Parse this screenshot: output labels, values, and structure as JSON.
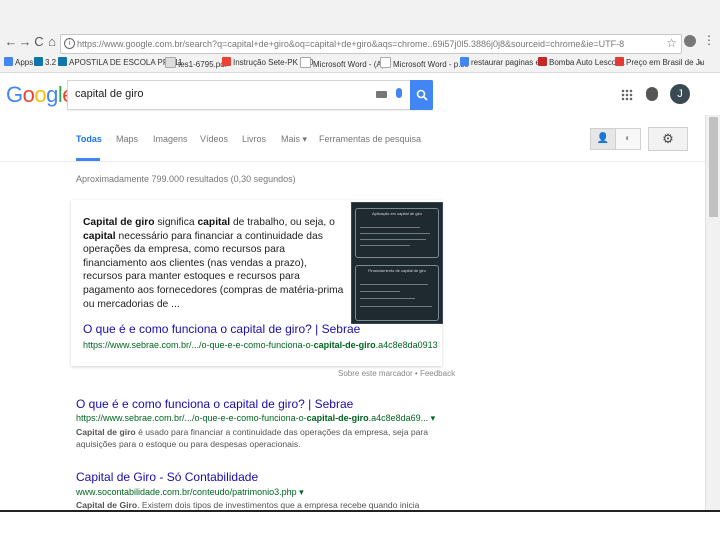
{
  "browser": {
    "url": "https://www.google.com.br/search?q=capital+de+giro&oq=capital+de+giro&aqs=chrome..69i57j0l5.3886j0j8&sourceid=chrome&ie=UTF-8",
    "nav_icons": {
      "back": "←",
      "forward": "→",
      "reload": "C",
      "home": "⌂"
    },
    "bookmarks": [
      {
        "label": "Apps",
        "icon_color": "#4285f4"
      },
      {
        "label": "3.2",
        "icon_color": "#0e76a8"
      },
      {
        "label": "APOSTILA DE ESCOLA PP 111",
        "icon_color": "#0e76a8"
      },
      {
        "label": "tes1-6795.pdf",
        "icon_color": "#e0e0e0"
      },
      {
        "label": "Instrução Sete-PK 140",
        "icon_color": "#ea4335"
      },
      {
        "label": "Microsoft Word - (A)",
        "icon_color": "#ffffff"
      },
      {
        "label": "Microsoft Word - p.sc",
        "icon_color": "#ffffff"
      },
      {
        "label": "restaurar paginas ee",
        "icon_color": "#4285f4"
      },
      {
        "label": "Bomba Auto Lescova",
        "icon_color": "#c62828"
      },
      {
        "label": "Preço em Brasil de Ju",
        "icon_color": "#e53935"
      }
    ]
  },
  "google": {
    "logo": [
      "G",
      "o",
      "o",
      "g",
      "l",
      "e"
    ],
    "logo_colors": [
      "#4285f4",
      "#ea4335",
      "#fbbc05",
      "#4285f4",
      "#34a853",
      "#ea4335"
    ],
    "query": "capital de giro",
    "search_symbol": "🔍",
    "avatar_letter": "J"
  },
  "tabs": [
    "Todas",
    "Maps",
    "Imagens",
    "Vídeos",
    "Livros",
    "Mais ▾",
    "Ferramentas de pesquisa"
  ],
  "stats": "Aproximadamente 799.000 resultados (0,30 segundos)",
  "featured": {
    "snippet_bold_1": "Capital de giro",
    "snippet_text_1": " significa ",
    "snippet_bold_2": "capital",
    "snippet_text_2": " de trabalho, ou seja, o ",
    "snippet_bold_3": "capital",
    "snippet_text_3": " necessário para financiar a continuidade das operações da empresa, como recursos para financiamento aos clientes (nas vendas a prazo), recursos para manter estoques e recursos para pagamento aos fornecedores (compras de matéria-prima ou mercadorias de ...",
    "thumb_title_1": "Aplicação em capital de giro",
    "thumb_title_2": "Financiamento de capital de giro",
    "title": "O que é e como funciona o capital de giro? | Sebrae",
    "url_prefix": "https://www.sebrae.com.br/.../o-que-e-e-como-funciona-o-",
    "url_bold": "capital-de-giro",
    "url_suffix": ".a4c8e8da0913",
    "feedback": "Sobre este marcador  •  Feedback"
  },
  "results": [
    {
      "title": "O que é e como funciona o capital de giro? | Sebrae",
      "url_prefix": "https://www.sebrae.com.br/.../o-que-e-e-como-funciona-o-",
      "url_bold": "capital-de-giro",
      "url_suffix": ".a4c8e8da69... ▾",
      "desc_bold": "Capital de giro",
      "desc": " é usado para financiar a continuidade das operações da empresa, seja para aquisições para o estoque ou para despesas operacionais."
    },
    {
      "title_plain": "Capital de Giro",
      "title_rest": " - Só Contabilidade",
      "url": "www.socontabilidade.com.br/conteudo/patrimonio3.php ▾",
      "desc_bold": "Capital de Giro",
      "desc": ". Existem dois tipos de investimentos que a empresa recebe quando inicia suas"
    }
  ]
}
